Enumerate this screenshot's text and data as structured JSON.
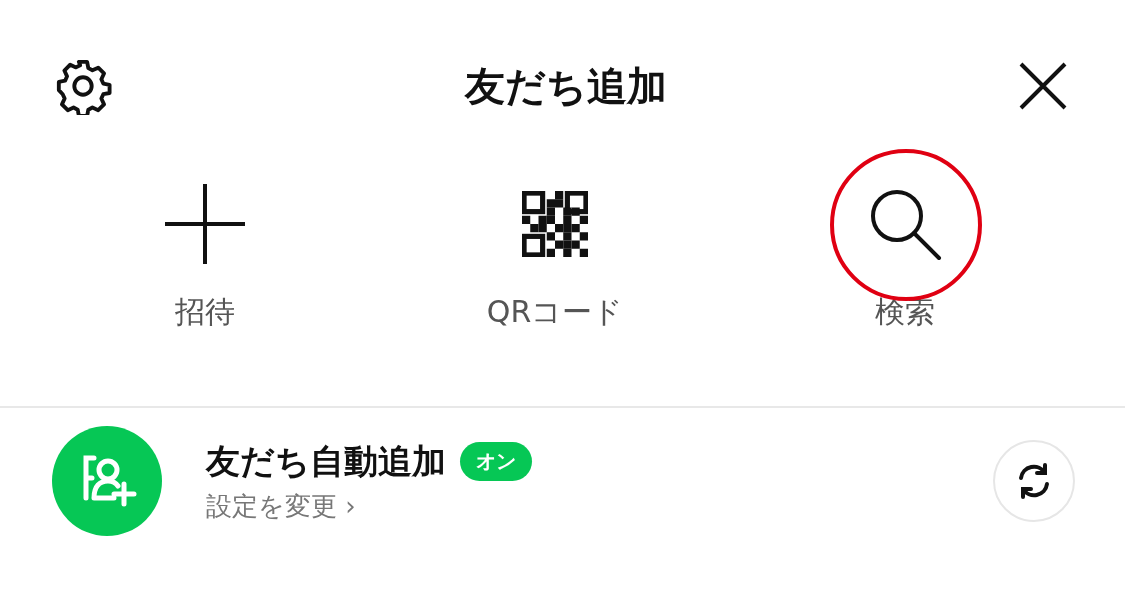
{
  "header": {
    "title": "友だち追加"
  },
  "actions": [
    {
      "kind": "plus",
      "label": "招待",
      "highlighted": false
    },
    {
      "kind": "qr",
      "label": "QRコード",
      "highlighted": false
    },
    {
      "kind": "search",
      "label": "検索",
      "highlighted": true
    }
  ],
  "auto_add": {
    "title": "友だち自動追加",
    "badge": "オン",
    "on": true,
    "subtitle": "設定を変更",
    "chevron": "›"
  }
}
